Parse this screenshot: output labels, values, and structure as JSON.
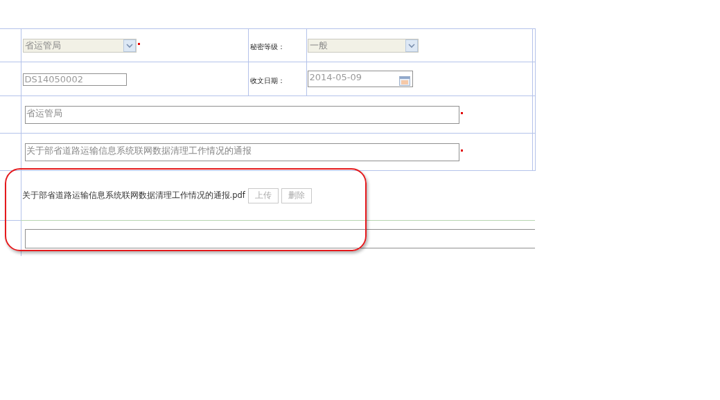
{
  "form": {
    "issuer": {
      "value": "省运管局",
      "disabled": true,
      "required": true
    },
    "secrecy": {
      "label": "秘密等级：",
      "value": "一般",
      "disabled": true
    },
    "doc_number": {
      "value": "DS14050002"
    },
    "receive_date": {
      "label": "收文日期：",
      "value": "2014-05-09"
    },
    "issuing_unit": {
      "value": "省运管局",
      "required": true
    },
    "doc_title": {
      "value": "关于部省道路运输信息系统联网数据清理工作情况的通报",
      "required": true
    },
    "attachment": {
      "filename": "关于部省道路运输信息系统联网数据清理工作情况的通报.pdf",
      "buttons": [
        {
          "label": "上传",
          "disabled": true
        },
        {
          "label": "删除",
          "disabled": true
        }
      ]
    }
  }
}
